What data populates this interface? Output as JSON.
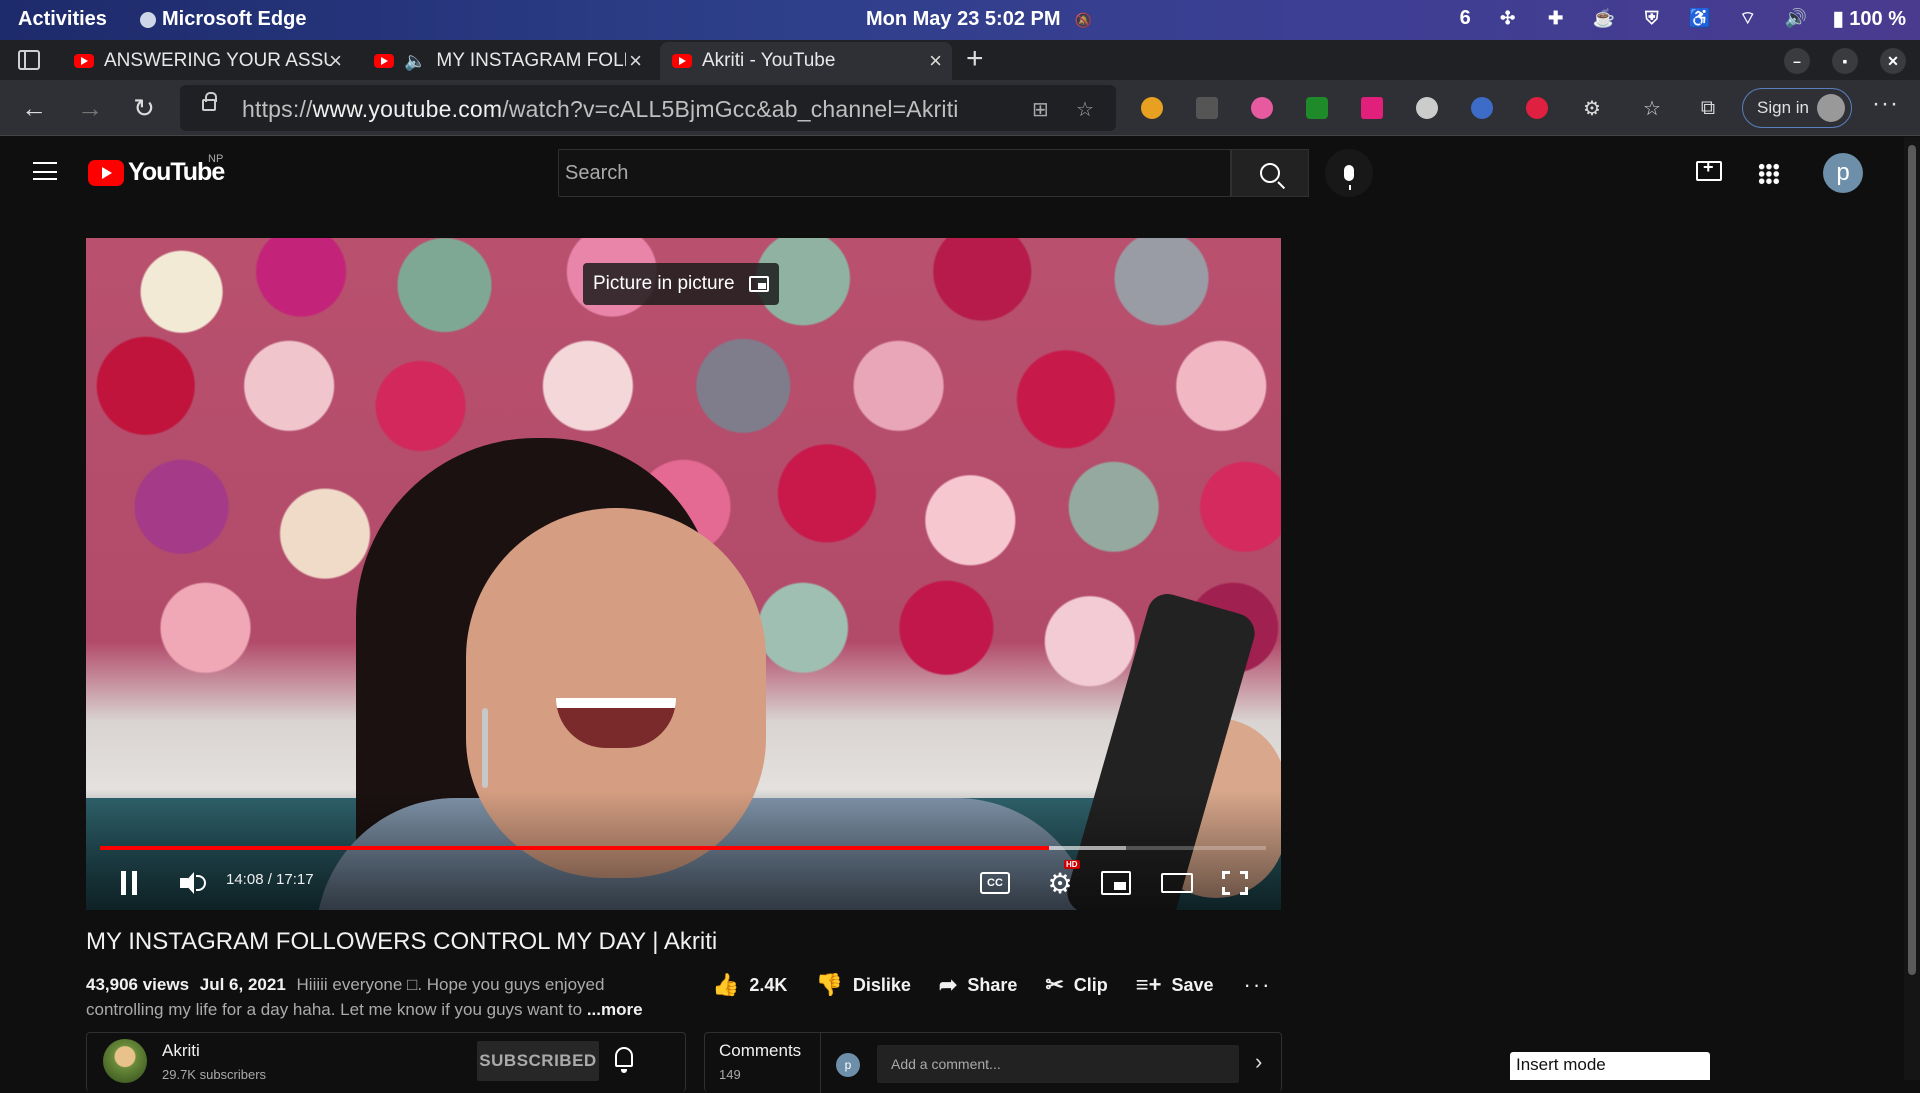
{
  "system_bar": {
    "activities": "Activities",
    "app_name": "Microsoft Edge",
    "clock": "Mon May 23  5:02 PM",
    "workspace_count": "6",
    "battery": "100 %"
  },
  "browser": {
    "tabs": [
      {
        "title": "ANSWERING YOUR ASSUMPTIONS",
        "audio": false,
        "active": false
      },
      {
        "title": "MY INSTAGRAM FOLLOWERS CONTROL MY DAY",
        "audio": true,
        "active": false
      },
      {
        "title": "Akriti - YouTube",
        "audio": false,
        "active": true
      }
    ],
    "new_tab_label": "+",
    "url_host_prefix": "https://",
    "url_host": "www.youtube.com",
    "url_path": "/watch?v=cALL5BjmGcc&ab_channel=Akriti",
    "sign_in": "Sign in",
    "extension_colors": [
      "#e8a020",
      "#555555",
      "#e85aa0",
      "#1e8a2a",
      "#e0207a",
      "#cccccc",
      "#3c6cc8",
      "#e02040"
    ]
  },
  "youtube": {
    "logo_text": "YouTube",
    "region": "NP",
    "search_placeholder": "Search",
    "avatar_letter": "p"
  },
  "player": {
    "pip_tooltip": "Picture in picture",
    "current_time": "14:08",
    "duration": "17:17",
    "time_display": "14:08 / 17:17",
    "played_fraction": 0.814,
    "loaded_fraction": 0.88,
    "cc_label": "CC",
    "hd_badge": "HD",
    "icons": [
      "pause-icon",
      "volume-icon",
      "captions-icon",
      "settings-icon",
      "miniplayer-icon",
      "theater-icon",
      "fullscreen-icon"
    ]
  },
  "video": {
    "title": "MY INSTAGRAM FOLLOWERS CONTROL MY DAY | Akriti",
    "views": "43,906 views",
    "date": "Jul 6, 2021",
    "description": "Hiiiii everyone □. Hope you guys enjoyed controlling my life for a day haha. Let me know if you guys want to",
    "more": "...more",
    "likes": "2.4K",
    "dislike": "Dislike",
    "share": "Share",
    "clip": "Clip",
    "save": "Save"
  },
  "channel": {
    "name": "Akriti",
    "subscribers": "29.7K subscribers",
    "subscribe_state": "SUBSCRIBED"
  },
  "comments": {
    "label": "Comments",
    "count": "149",
    "avatar_letter": "p",
    "placeholder": "Add a comment..."
  },
  "vim_status": "Insert mode"
}
